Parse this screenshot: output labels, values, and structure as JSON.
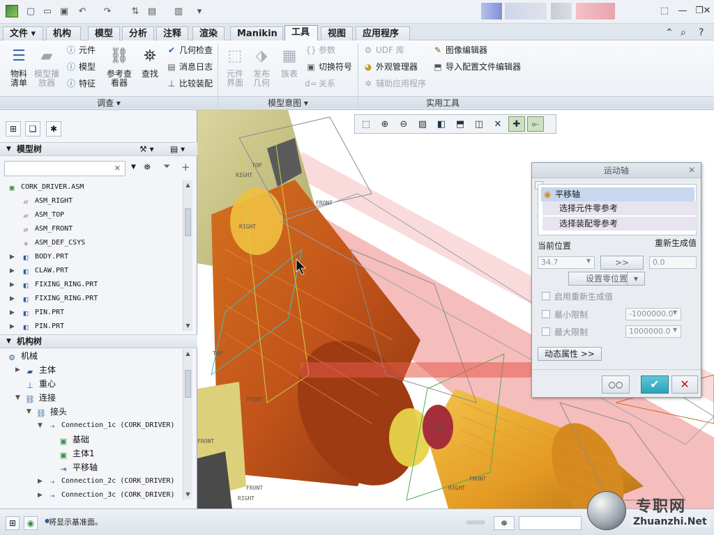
{
  "titlebar": {
    "quick_access": [
      "new-icon",
      "open-icon",
      "save-icon",
      "undo-icon",
      "redo-icon",
      "regenerate-icon",
      "windows-icon",
      "close-window-icon",
      "customize-icon"
    ],
    "window_controls": [
      "help-icon",
      "minimize-icon",
      "restore-icon",
      "close-icon"
    ]
  },
  "menubar": {
    "tabs": [
      "文件",
      "机构",
      "模型",
      "分析",
      "注释",
      "渲染",
      "Manikin",
      "工具",
      "视图",
      "应用程序"
    ],
    "active_tab": "工具"
  },
  "ribbon": {
    "groups": {
      "investigate": "调查",
      "model_intent": "模型意图",
      "utilities": "实用工具"
    },
    "bom": "物料清单",
    "model_player": "模型播放器",
    "component": "元件",
    "model": "模型",
    "feature": "特征",
    "reference_viewer": "参考查看器",
    "find": "查找",
    "geometry_check": "几何检查",
    "message_log": "消息日志",
    "compare_assembly": "比较装配",
    "component_interface": "元件界面",
    "publish_geometry": "发布几何",
    "family_table": "族表",
    "parameters": "参数",
    "switch_symbols": "切换符号",
    "relations": "关系",
    "udf_library": "UDF 库",
    "appearance_manager": "外观管理器",
    "auxiliary_apps": "辅助应用程序",
    "image_editor": "图像编辑器",
    "import_config_editor": "导入配置文件编辑器"
  },
  "leftpanel": {
    "model_tree_title": "模型树",
    "model_tree": [
      {
        "label": "CORK_DRIVER.ASM",
        "icon": "assembly-icon",
        "level": 0,
        "expander": ""
      },
      {
        "label": "ASM_RIGHT",
        "icon": "datum-plane-icon",
        "level": 1,
        "expander": ""
      },
      {
        "label": "ASM_TOP",
        "icon": "datum-plane-icon",
        "level": 1,
        "expander": ""
      },
      {
        "label": "ASM_FRONT",
        "icon": "datum-plane-icon",
        "level": 1,
        "expander": ""
      },
      {
        "label": "ASM_DEF_CSYS",
        "icon": "csys-icon",
        "level": 1,
        "expander": ""
      },
      {
        "label": "BODY.PRT",
        "icon": "part-icon",
        "level": 1,
        "expander": "▶"
      },
      {
        "label": "CLAW.PRT",
        "icon": "part-icon",
        "level": 1,
        "expander": "▶"
      },
      {
        "label": "FIXING_RING.PRT",
        "icon": "part-icon",
        "level": 1,
        "expander": "▶"
      },
      {
        "label": "FIXING_RING.PRT",
        "icon": "part-icon",
        "level": 1,
        "expander": "▶"
      },
      {
        "label": "PIN.PRT",
        "icon": "part-icon",
        "level": 1,
        "expander": "▶"
      },
      {
        "label": "PIN.PRT",
        "icon": "part-icon",
        "level": 1,
        "expander": "▶"
      }
    ],
    "mech_tree_title": "机构树",
    "mech_tree": [
      {
        "label": "机械",
        "level": 0,
        "expander": "",
        "cn": true
      },
      {
        "label": "主体",
        "level": 1,
        "expander": "▶",
        "cn": true
      },
      {
        "label": "重心",
        "level": 1,
        "expander": "",
        "cn": true
      },
      {
        "label": "连接",
        "level": 1,
        "expander": "▼",
        "cn": true
      },
      {
        "label": "接头",
        "level": 2,
        "expander": "▼",
        "cn": true
      },
      {
        "label": "Connection_1c  (CORK_DRIVER)",
        "level": 3,
        "expander": "▼",
        "cn": false
      },
      {
        "label": "基础",
        "level": 4,
        "expander": "",
        "cn": true
      },
      {
        "label": "主体1",
        "level": 4,
        "expander": "",
        "cn": true
      },
      {
        "label": "平移轴",
        "level": 4,
        "expander": "",
        "cn": true
      },
      {
        "label": "Connection_2c  (CORK_DRIVER)",
        "level": 3,
        "expander": "▶",
        "cn": false
      },
      {
        "label": "Connection_3c  (CORK_DRIVER)",
        "level": 3,
        "expander": "▶",
        "cn": false
      }
    ]
  },
  "viewport": {
    "labels": [
      "TOP",
      "RIGHT",
      "RIGHT",
      "FRONT",
      "TOP",
      "FRONT",
      "FRONT",
      "TOP",
      "FRONT",
      "RIGHT",
      "FRONT",
      "RIGHT"
    ],
    "toolbar_icons": [
      "zoom-fit-icon",
      "zoom-in-icon",
      "zoom-out-icon",
      "repaint-icon",
      "display-style-icon",
      "saved-views-icon",
      "view-manager-icon",
      "perspective-icon",
      "datum-display-icon",
      "annotation-display-icon",
      "spin-center-icon"
    ]
  },
  "dialog": {
    "title": "运动轴",
    "axis_item": "平移轴",
    "select_component_ref": "选择元件零参考",
    "select_assembly_ref": "选择装配零参考",
    "current_position": "当前位置",
    "regen_value": "重新生成值",
    "current_value": "34.7",
    "regen_input": "0.0",
    "set_zero": "设置零位置",
    "enable_regen": "启用重新生成值",
    "min_limit": "最小限制",
    "min_value": "-1000000.0",
    "max_limit": "最大限制",
    "max_value": "1000000.0",
    "dynamic_props": "动态属性  >>"
  },
  "statusbar": {
    "message": "将显示基准面。"
  },
  "watermark": {
    "site": "专职网",
    "url": "Zhuanzhi.Net"
  }
}
